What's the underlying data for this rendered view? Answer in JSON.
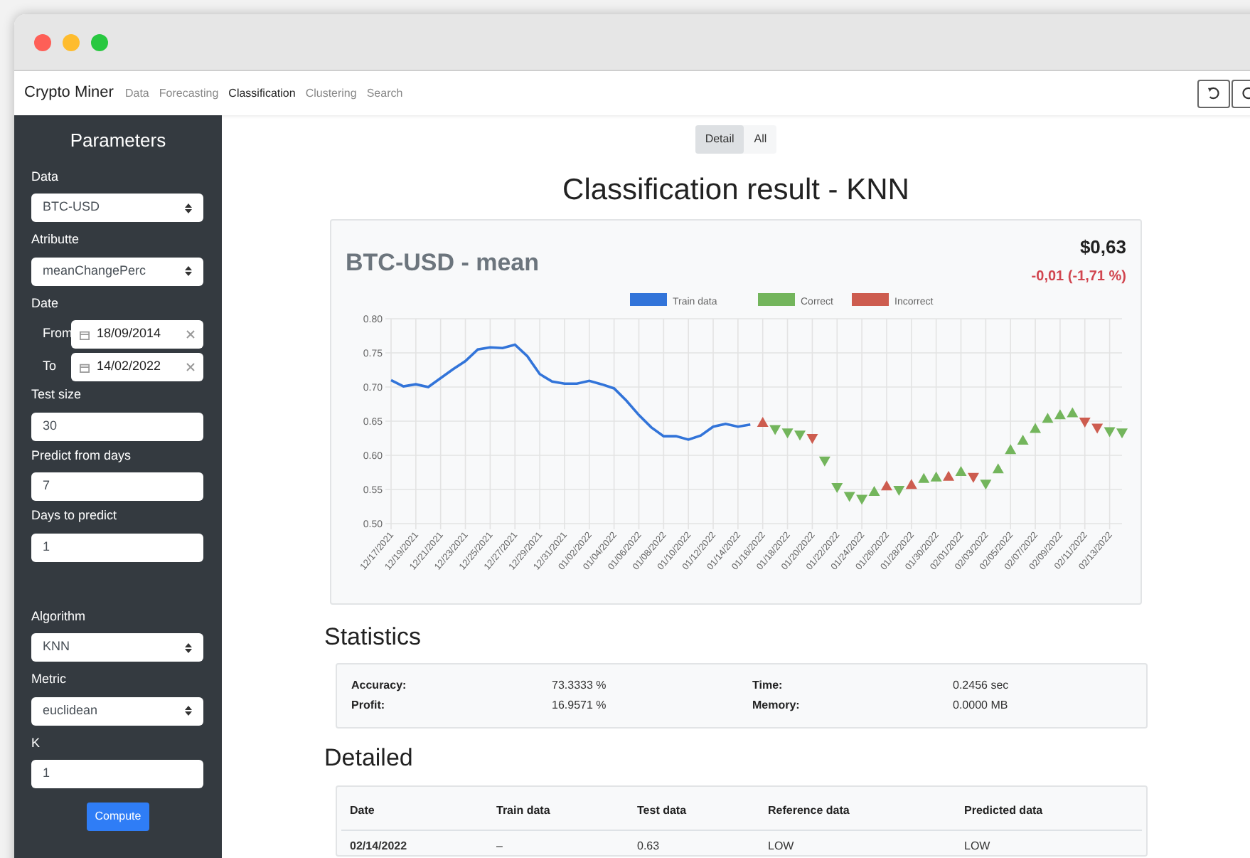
{
  "app": {
    "brand": "Crypto Miner"
  },
  "nav": [
    {
      "label": "Data",
      "selected": false
    },
    {
      "label": "Forecasting",
      "selected": false
    },
    {
      "label": "Classification",
      "selected": true
    },
    {
      "label": "Clustering",
      "selected": false
    },
    {
      "label": "Search",
      "selected": false
    }
  ],
  "sidebar": {
    "title": "Parameters",
    "fields": [
      {
        "kind": "select",
        "label": "Data",
        "value": "BTC-USD"
      },
      {
        "kind": "select",
        "label": "Atributte",
        "value": "meanChangePerc"
      },
      {
        "kind": "dates",
        "label": "Date",
        "from_label": "From",
        "from": "18/09/2014",
        "to_label": "To",
        "to": "14/02/2022"
      },
      {
        "kind": "input",
        "label": "Test size",
        "value": "30"
      },
      {
        "kind": "input",
        "label": "Predict from days",
        "value": "7"
      },
      {
        "kind": "input",
        "label": "Days to predict",
        "value": "1"
      },
      {
        "kind": "gap"
      },
      {
        "kind": "select",
        "label": "Algorithm",
        "value": "KNN"
      },
      {
        "kind": "select",
        "label": "Metric",
        "value": "euclidean"
      },
      {
        "kind": "input",
        "label": "K",
        "value": "1"
      }
    ],
    "button": "Compute"
  },
  "view_tabs": [
    {
      "label": "Detail",
      "selected": true
    },
    {
      "label": "All",
      "selected": false
    }
  ],
  "heading": "Classification result - KNN",
  "chart_card": {
    "title": "BTC-USD - mean",
    "price": "$0,63",
    "change": "-0,01 (-1,71 %)",
    "chart_data": {
      "type": "line",
      "grid": true,
      "legend": "top",
      "categories": [
        "12/17/2021",
        null,
        "12/19/2021",
        null,
        "12/21/2021",
        null,
        "12/23/2021",
        null,
        "12/25/2021",
        null,
        "12/27/2021",
        null,
        "12/29/2021",
        null,
        "12/31/2021",
        null,
        "01/02/2022",
        null,
        "01/04/2022",
        null,
        "01/06/2022",
        null,
        "01/08/2022",
        null,
        "01/10/2022",
        null,
        "01/12/2022",
        null,
        "01/14/2022",
        null,
        "01/16/2022",
        null,
        "01/18/2022",
        null,
        "01/20/2022",
        null,
        "01/22/2022",
        null,
        "01/24/2022",
        null,
        "01/26/2022",
        null,
        "01/28/2022",
        null,
        "01/30/2022",
        null,
        "02/01/2022",
        null,
        "02/03/2022",
        null,
        "02/05/2022",
        null,
        "02/07/2022",
        null,
        "02/09/2022",
        null,
        "02/11/2022",
        null,
        "02/13/2022",
        null
      ],
      "ylim": [
        0.5,
        0.8
      ],
      "yticks": [
        {
          "value": 0.5,
          "label": "0.50"
        },
        {
          "value": 0.55,
          "label": "0.55"
        },
        {
          "value": 0.6,
          "label": "0.60"
        },
        {
          "value": 0.65,
          "label": "0.65"
        },
        {
          "value": 0.7,
          "label": "0.70"
        },
        {
          "value": 0.75,
          "label": "0.75"
        },
        {
          "value": 0.8,
          "label": "0.80"
        }
      ],
      "series": [
        {
          "name": "Train data",
          "color": "#3274d9",
          "values": [
            0.71,
            0.701,
            0.704,
            0.7,
            0.713,
            0.726,
            0.738,
            0.755,
            0.758,
            0.757,
            0.762,
            0.745,
            0.719,
            0.708,
            0.705,
            0.705,
            0.709,
            0.704,
            0.698,
            0.68,
            0.659,
            0.641,
            0.628,
            0.628,
            0.623,
            0.629,
            0.642,
            0.646,
            0.642,
            0.645,
            null,
            null,
            null,
            null,
            null,
            null,
            null,
            null,
            null,
            null,
            null,
            null,
            null,
            null,
            null,
            null,
            null,
            null,
            null,
            null,
            null,
            null,
            null,
            null,
            null,
            null,
            null,
            null,
            null,
            null
          ]
        },
        {
          "name": "Correct",
          "type": "scatter",
          "color": "#73b55c",
          "values": [
            null,
            null,
            null,
            null,
            null,
            null,
            null,
            null,
            null,
            null,
            null,
            null,
            null,
            null,
            null,
            null,
            null,
            null,
            null,
            null,
            null,
            null,
            null,
            null,
            null,
            null,
            null,
            null,
            null,
            null,
            null,
            0.638,
            0.633,
            0.63,
            null,
            0.592,
            0.553,
            0.54,
            0.536,
            0.547,
            null,
            0.549,
            null,
            0.566,
            0.568,
            null,
            0.576,
            null,
            0.558,
            0.58,
            0.608,
            0.622,
            0.639,
            0.654,
            0.659,
            0.662,
            null,
            null,
            0.635,
            0.633
          ]
        },
        {
          "name": "Incorrect",
          "type": "scatter",
          "color": "#cd5c4f",
          "values": [
            null,
            null,
            null,
            null,
            null,
            null,
            null,
            null,
            null,
            null,
            null,
            null,
            null,
            null,
            null,
            null,
            null,
            null,
            null,
            null,
            null,
            null,
            null,
            null,
            null,
            null,
            null,
            null,
            null,
            null,
            0.648,
            null,
            null,
            null,
            0.625,
            null,
            null,
            null,
            null,
            null,
            0.555,
            null,
            0.557,
            null,
            null,
            0.569,
            null,
            0.568,
            null,
            null,
            null,
            null,
            null,
            null,
            null,
            null,
            0.649,
            0.64,
            null,
            null
          ]
        }
      ]
    }
  },
  "statistics": {
    "title": "Statistics",
    "items": [
      {
        "label": "Accuracy:",
        "value": "73.3333 %"
      },
      {
        "label": "Time:",
        "value": "0.2456 sec"
      },
      {
        "label": "Profit:",
        "value": "16.9571 %"
      },
      {
        "label": "Memory:",
        "value": "0.0000 MB"
      }
    ]
  },
  "detailed": {
    "title": "Detailed",
    "columns": [
      "Date",
      "Train data",
      "Test data",
      "Reference data",
      "Predicted data"
    ],
    "rows": [
      [
        "02/14/2022",
        "–",
        "0.63",
        "LOW",
        "LOW"
      ]
    ]
  }
}
